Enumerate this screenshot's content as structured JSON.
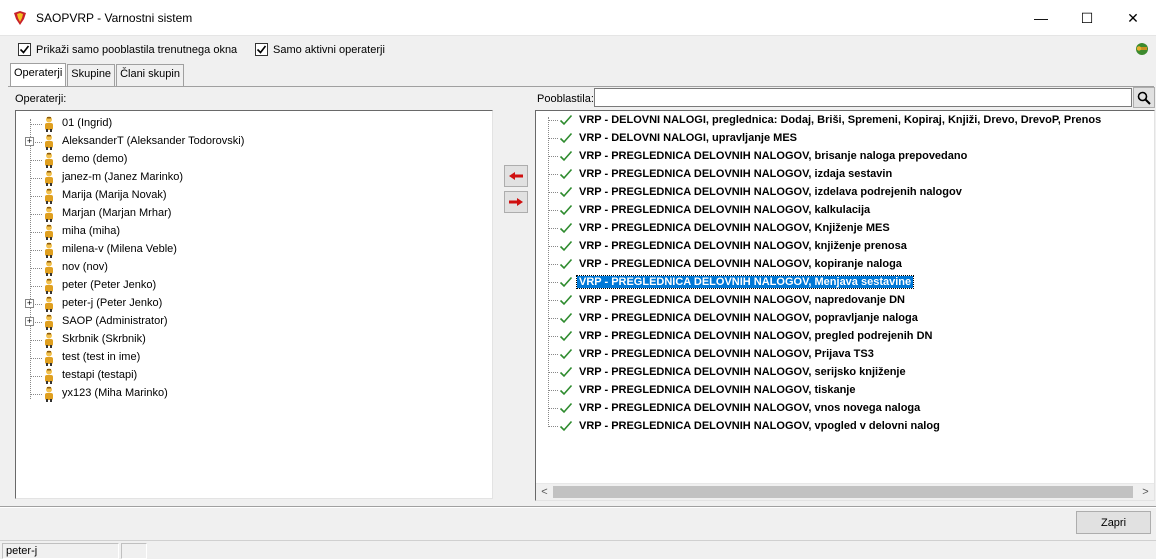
{
  "window": {
    "title": "SAOPVRP - Varnostni sistem",
    "minimize": "—",
    "maximize": "☐",
    "close": "✕"
  },
  "options": {
    "only_current_window_label": "Prikaži samo pooblastila trenutnega okna",
    "only_current_window_checked": true,
    "active_only_label": "Samo aktivni operaterji",
    "active_only_checked": true
  },
  "tabs": [
    {
      "label": "Operaterji",
      "active": true
    },
    {
      "label": "Skupine",
      "active": false
    },
    {
      "label": "Člani skupin",
      "active": false
    }
  ],
  "operators_label": "Operaterji:",
  "permissions_label": "Pooblastila:",
  "search": {
    "value": ""
  },
  "operators": [
    {
      "label": "01 (Ingrid)",
      "expandable": false
    },
    {
      "label": "AleksanderT (Aleksander Todorovski)",
      "expandable": true
    },
    {
      "label": "demo (demo)",
      "expandable": false
    },
    {
      "label": "janez-m (Janez Marinko)",
      "expandable": false
    },
    {
      "label": "Marija (Marija Novak)",
      "expandable": false
    },
    {
      "label": "Marjan (Marjan Mrhar)",
      "expandable": false
    },
    {
      "label": "miha (miha)",
      "expandable": false
    },
    {
      "label": "milena-v (Milena Veble)",
      "expandable": false
    },
    {
      "label": "nov (nov)",
      "expandable": false
    },
    {
      "label": "peter (Peter Jenko)",
      "expandable": false
    },
    {
      "label": "peter-j (Peter Jenko)",
      "expandable": true
    },
    {
      "label": "SAOP (Administrator)",
      "expandable": true
    },
    {
      "label": "Skrbnik (Skrbnik)",
      "expandable": false
    },
    {
      "label": "test (test in ime)",
      "expandable": false
    },
    {
      "label": "testapi (testapi)",
      "expandable": false
    },
    {
      "label": "yx123 (Miha Marinko)",
      "expandable": false
    }
  ],
  "permissions": [
    {
      "label": "VRP - DELOVNI NALOGI, preglednica: Dodaj, Briši, Spremeni, Kopiraj, Knjiži, Drevo, DrevoP, Prenos",
      "selected": false
    },
    {
      "label": "VRP - DELOVNI NALOGI, upravljanje MES",
      "selected": false
    },
    {
      "label": "VRP - PREGLEDNICA DELOVNIH NALOGOV, brisanje naloga prepovedano",
      "selected": false
    },
    {
      "label": "VRP - PREGLEDNICA DELOVNIH NALOGOV, izdaja sestavin",
      "selected": false
    },
    {
      "label": "VRP - PREGLEDNICA DELOVNIH NALOGOV, izdelava podrejenih nalogov",
      "selected": false
    },
    {
      "label": "VRP - PREGLEDNICA DELOVNIH NALOGOV, kalkulacija",
      "selected": false
    },
    {
      "label": "VRP - PREGLEDNICA DELOVNIH NALOGOV, Knjiženje MES",
      "selected": false
    },
    {
      "label": "VRP - PREGLEDNICA DELOVNIH NALOGOV, knjiženje prenosa",
      "selected": false
    },
    {
      "label": "VRP - PREGLEDNICA DELOVNIH NALOGOV, kopiranje naloga",
      "selected": false
    },
    {
      "label": "VRP - PREGLEDNICA DELOVNIH NALOGOV, Menjava sestavine",
      "selected": true
    },
    {
      "label": "VRP - PREGLEDNICA DELOVNIH NALOGOV, napredovanje DN",
      "selected": false
    },
    {
      "label": "VRP - PREGLEDNICA DELOVNIH NALOGOV, popravljanje naloga",
      "selected": false
    },
    {
      "label": "VRP - PREGLEDNICA DELOVNIH NALOGOV, pregled podrejenih DN",
      "selected": false
    },
    {
      "label": "VRP - PREGLEDNICA DELOVNIH NALOGOV, Prijava TS3",
      "selected": false
    },
    {
      "label": "VRP - PREGLEDNICA DELOVNIH NALOGOV, serijsko knjiženje",
      "selected": false
    },
    {
      "label": "VRP - PREGLEDNICA DELOVNIH NALOGOV, tiskanje",
      "selected": false
    },
    {
      "label": "VRP - PREGLEDNICA DELOVNIH NALOGOV, vnos novega naloga",
      "selected": false
    },
    {
      "label": "VRP - PREGLEDNICA DELOVNIH NALOGOV, vpogled v delovni nalog",
      "selected": false
    }
  ],
  "buttons": {
    "close_label": "Zapri"
  },
  "scroll": {
    "left_arrow": "<",
    "right_arrow": ">"
  },
  "status": {
    "user": "peter-j"
  },
  "colors": {
    "selection": "#0078d7",
    "check": "#2e8b2e",
    "arrow_red": "#d01010"
  }
}
